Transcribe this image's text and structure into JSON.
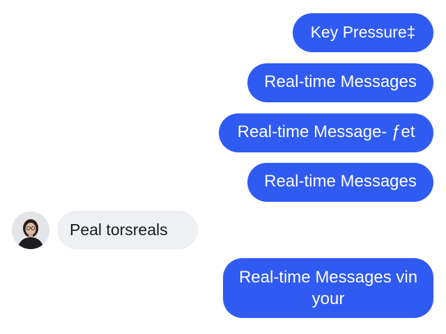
{
  "conversation": {
    "messages": [
      {
        "direction": "outgoing",
        "text": "Key Pressure‡"
      },
      {
        "direction": "outgoing",
        "text": "Real-time Messages"
      },
      {
        "direction": "outgoing",
        "text": "Real-time Message- ƒet"
      },
      {
        "direction": "outgoing",
        "text": "Real-time Messages"
      },
      {
        "direction": "incoming",
        "text": "Peal torsreals",
        "avatar": "user-avatar"
      },
      {
        "direction": "outgoing",
        "text": "Real-time Messages vin your"
      }
    ]
  },
  "colors": {
    "outgoing_bubble": "#2f5bf2",
    "incoming_bubble": "#eef0f3",
    "outgoing_text": "#ffffff",
    "incoming_text": "#1a1a1a"
  }
}
